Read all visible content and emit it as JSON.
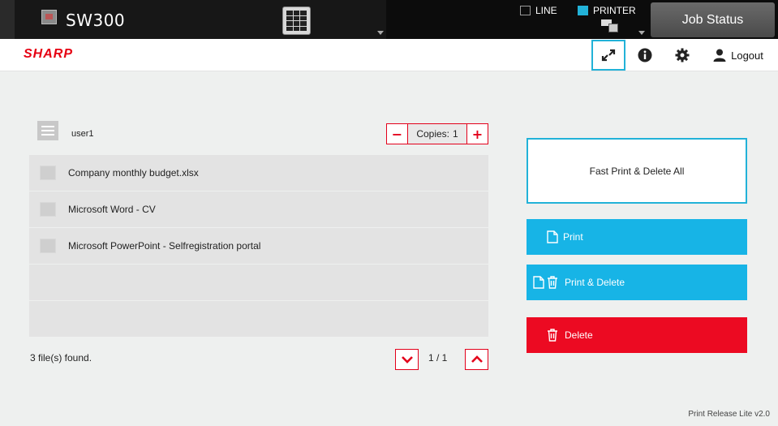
{
  "topbar": {
    "device_name": "SW300",
    "line_label": "LINE",
    "printer_label": "PRINTER",
    "job_status_label": "Job Status"
  },
  "header": {
    "logo": "SHARP",
    "logout_label": "Logout"
  },
  "user": {
    "name": "user1"
  },
  "copies": {
    "label": "Copies:",
    "value": "1",
    "minus": "−",
    "plus": "+"
  },
  "files": [
    {
      "name": "Company monthly budget.xlsx"
    },
    {
      "name": "Microsoft Word - CV"
    },
    {
      "name": "Microsoft PowerPoint - Selfregistration portal"
    },
    {
      "name": ""
    },
    {
      "name": ""
    }
  ],
  "footer": {
    "found_text": "3 file(s) found.",
    "page_text": "1 / 1"
  },
  "actions": {
    "fast_label": "Fast Print & Delete All",
    "print_label": "Print",
    "print_delete_label": "Print & Delete",
    "delete_label": "Delete"
  },
  "version": "Print Release Lite v2.0",
  "colors": {
    "accent": "#22b2d8",
    "danger": "#e3001b",
    "brand": "#e60012"
  }
}
